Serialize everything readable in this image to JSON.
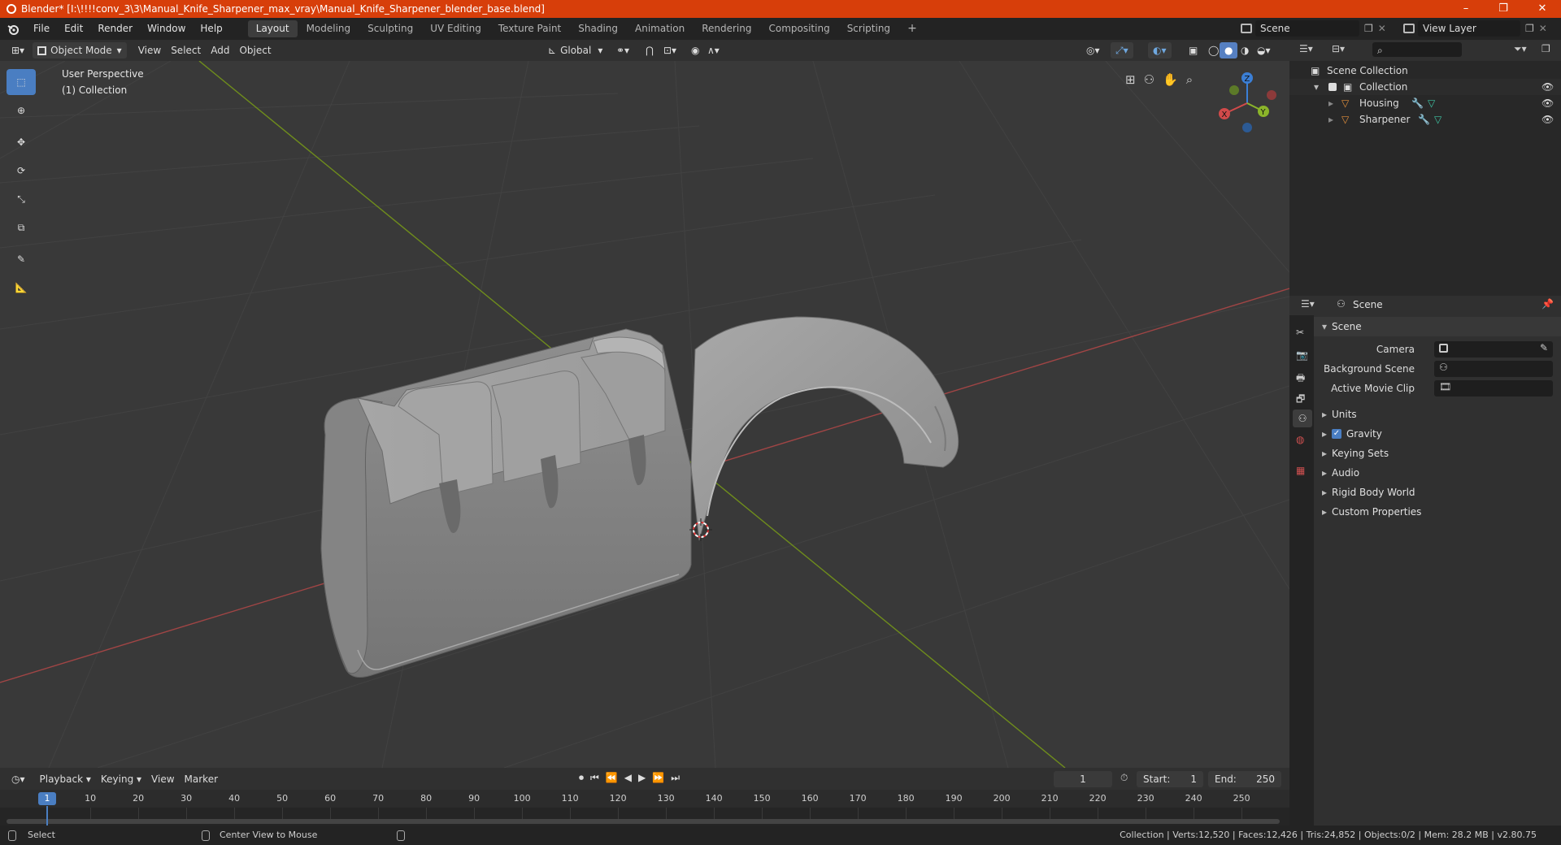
{
  "window": {
    "title": "Blender* [I:\\!!!!conv_3\\3\\Manual_Knife_Sharpener_max_vray\\Manual_Knife_Sharpener_blender_base.blend]",
    "minimize": "–",
    "maximize": "❐",
    "close": "✕"
  },
  "menubar": {
    "items": [
      "File",
      "Edit",
      "Render",
      "Window",
      "Help"
    ]
  },
  "workspaces": {
    "tabs": [
      "Layout",
      "Modeling",
      "Sculpting",
      "UV Editing",
      "Texture Paint",
      "Shading",
      "Animation",
      "Rendering",
      "Compositing",
      "Scripting"
    ],
    "add": "+"
  },
  "scene_selector": {
    "value": "Scene"
  },
  "viewlayer_selector": {
    "value": "View Layer"
  },
  "viewport_header": {
    "mode": "Object Mode",
    "menus": [
      "View",
      "Select",
      "Add",
      "Object"
    ],
    "orientation": "Global"
  },
  "viewport": {
    "view_name": "User Perspective",
    "collection_label": "(1) Collection",
    "gizmo": {
      "x": "X",
      "y": "Y",
      "z": "Z"
    },
    "colors": {
      "x_axis": "#b44a4a",
      "y_axis": "#7b9a1f",
      "grid": "#3f3f3f",
      "bg": "#393939",
      "model": "#9a9a9a"
    }
  },
  "outliner": {
    "root": "Scene Collection",
    "collection": "Collection",
    "objects": [
      "Housing",
      "Sharpener"
    ]
  },
  "properties": {
    "header": "Scene",
    "panel": "Scene",
    "fields": {
      "camera": "Camera",
      "background_scene": "Background Scene",
      "active_movie_clip": "Active Movie Clip"
    },
    "sections": [
      "Units",
      "Gravity",
      "Keying Sets",
      "Audio",
      "Rigid Body World",
      "Custom Properties"
    ],
    "gravity_checked": true
  },
  "timeline_header": {
    "menus": [
      "Playback",
      "Keying",
      "View",
      "Marker"
    ],
    "current_frame": "1",
    "start_label": "Start:",
    "start_value": "1",
    "end_label": "End:",
    "end_value": "250"
  },
  "timeline": {
    "ticks": [
      "1",
      "10",
      "20",
      "30",
      "40",
      "50",
      "60",
      "70",
      "80",
      "90",
      "100",
      "110",
      "120",
      "130",
      "140",
      "150",
      "160",
      "170",
      "180",
      "190",
      "200",
      "210",
      "220",
      "230",
      "240",
      "250"
    ]
  },
  "statusbar": {
    "select": "Select",
    "center_view": "Center View to Mouse",
    "stats": "Collection | Verts:12,520 | Faces:12,426 | Tris:24,852 | Objects:0/2 | Mem: 28.2 MB | v2.80.75"
  }
}
